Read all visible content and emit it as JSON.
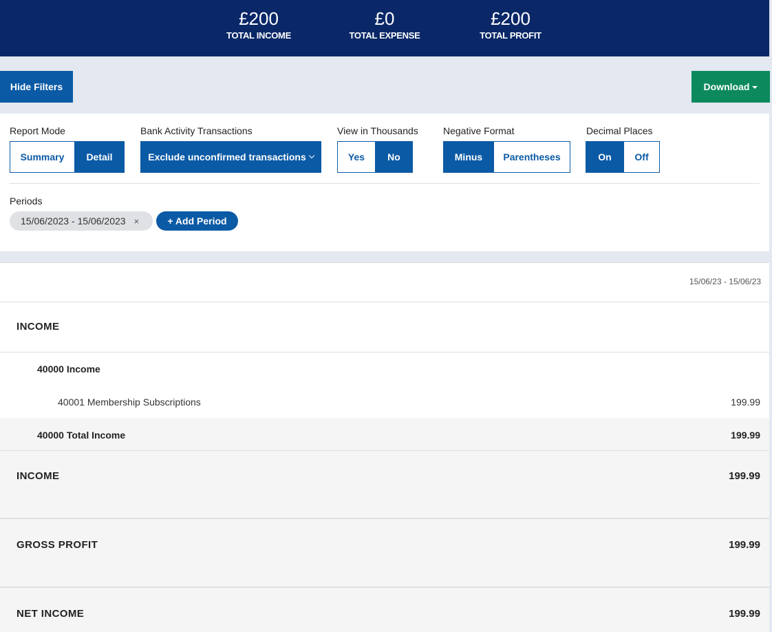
{
  "summary": {
    "income": {
      "amount": "£200",
      "label": "TOTAL INCOME"
    },
    "expense": {
      "amount": "£0",
      "label": "TOTAL EXPENSE"
    },
    "profit": {
      "amount": "£200",
      "label": "TOTAL PROFIT"
    }
  },
  "toolbar": {
    "hide_filters": "Hide Filters",
    "download": "Download"
  },
  "filters": {
    "report_mode": {
      "label": "Report Mode",
      "options": [
        "Summary",
        "Detail"
      ],
      "selected": "Detail"
    },
    "bank_activity": {
      "label": "Bank Activity Transactions",
      "value": "Exclude unconfirmed transactions"
    },
    "view_thousands": {
      "label": "View in Thousands",
      "options": [
        "Yes",
        "No"
      ],
      "selected": "No"
    },
    "negative_format": {
      "label": "Negative Format",
      "options": [
        "Minus",
        "Parentheses"
      ],
      "selected": "Minus"
    },
    "decimal_places": {
      "label": "Decimal Places",
      "options": [
        "On",
        "Off"
      ],
      "selected": "On"
    },
    "periods": {
      "label": "Periods",
      "chip": "15/06/2023 - 15/06/2023",
      "chip_remove": "×",
      "add": "+ Add Period"
    }
  },
  "report": {
    "period_header": "15/06/23 - 15/06/23",
    "income_section_title": "INCOME",
    "group_title": "40000 Income",
    "account_line": {
      "label": "40001 Membership Subscriptions",
      "value": "199.99"
    },
    "group_total": {
      "label": "40000 Total Income",
      "value": "199.99"
    },
    "income_total": {
      "label": "INCOME",
      "value": "199.99"
    },
    "gross_profit": {
      "label": "GROSS PROFIT",
      "value": "199.99"
    },
    "net_income": {
      "label": "NET INCOME",
      "value": "199.99"
    }
  },
  "colors": {
    "header_navy": "#0a2868",
    "primary_blue": "#0b5aa5",
    "download_green": "#0c8a5e"
  }
}
